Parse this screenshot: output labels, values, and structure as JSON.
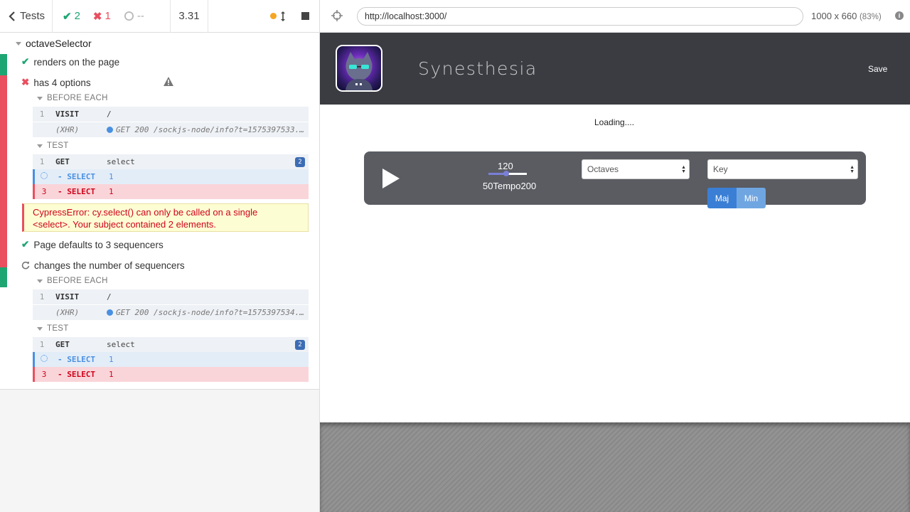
{
  "reporter": {
    "back_label": "Tests",
    "passed": "2",
    "failed": "1",
    "pending": "--",
    "duration": "3.31",
    "suite_title": "octaveSelector",
    "tests": [
      {
        "title": "renders on the page",
        "state": "passed"
      },
      {
        "title": "has 4 options",
        "state": "failed"
      },
      {
        "title": "Page defaults to 3 sequencers",
        "state": "passed"
      },
      {
        "title": "changes the number of sequencers",
        "state": "running"
      }
    ],
    "hooks": {
      "before_each": "BEFORE EACH",
      "test": "TEST"
    },
    "commands_t2": {
      "visit": {
        "num": "1",
        "name": "VISIT",
        "msg": "/"
      },
      "xhr": {
        "name": "(XHR)",
        "msg": "GET 200 /sockjs-node/info?t=1575397533..."
      },
      "get": {
        "num": "1",
        "name": "GET",
        "msg": "select",
        "badge": "2"
      },
      "select_pending": {
        "name": "- SELECT",
        "msg": "1"
      },
      "select_err": {
        "num": "3",
        "name": "- SELECT",
        "msg": "1"
      }
    },
    "commands_t4": {
      "visit": {
        "num": "1",
        "name": "VISIT",
        "msg": "/"
      },
      "xhr": {
        "name": "(XHR)",
        "msg": "GET 200 /sockjs-node/info?t=1575397534..."
      },
      "get": {
        "num": "1",
        "name": "GET",
        "msg": "select",
        "badge": "2"
      },
      "select_pending": {
        "name": "- SELECT",
        "msg": "1"
      },
      "select_err": {
        "num": "3",
        "name": "- SELECT",
        "msg": "1"
      }
    },
    "error_line1": "CypressError: cy.select() can only be called on a single",
    "error_line2": "<select>. Your subject contained 2 elements."
  },
  "aut": {
    "url": "http://localhost:3000/",
    "viewport": "1000 x 660",
    "scale": "(83%)",
    "app": {
      "title": "Synesthesia",
      "save_label": "Save",
      "loading": "Loading....",
      "tempo_value": "120",
      "tempo_min": "50",
      "tempo_label": "Tempo",
      "tempo_max": "200",
      "tempo_fraction": 0.47,
      "octaves_placeholder": "Octaves",
      "key_placeholder": "Key",
      "maj_label": "Maj",
      "min_label": "Min"
    }
  },
  "colors": {
    "pass": "#1ea672",
    "fail": "#e94f5f",
    "accent": "#4a90e2",
    "header": "#3a3c42"
  }
}
